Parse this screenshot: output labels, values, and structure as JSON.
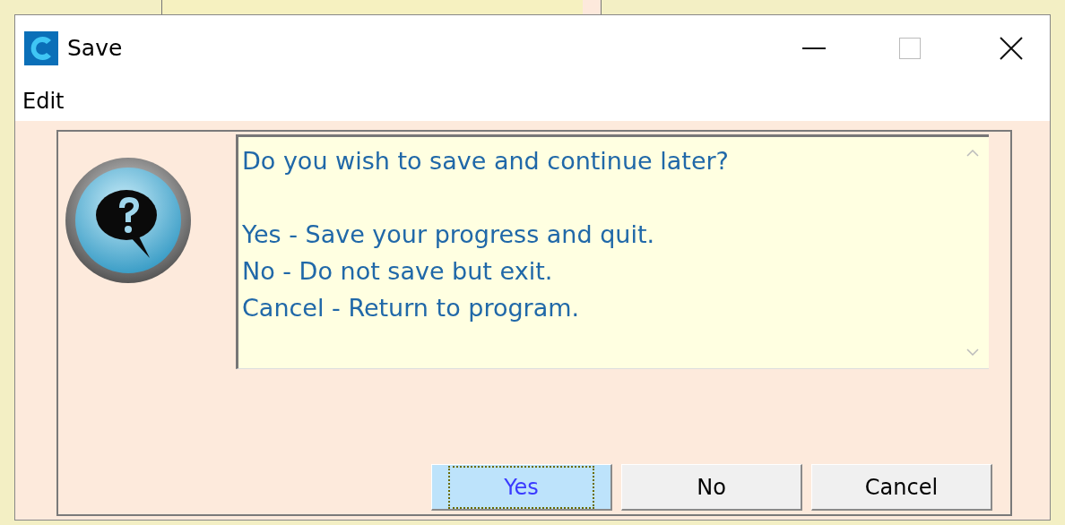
{
  "window": {
    "title": "Save"
  },
  "menu": [
    {
      "label": "Edit"
    }
  ],
  "message": {
    "question": "Do you wish to save and continue later?",
    "lines": [
      "Yes - Save your progress and quit.",
      "No - Do not save but exit.",
      "Cancel - Return to program."
    ]
  },
  "buttons": [
    {
      "label": "Yes",
      "selected": true
    },
    {
      "label": "No",
      "selected": false
    },
    {
      "label": "Cancel",
      "selected": false
    }
  ]
}
